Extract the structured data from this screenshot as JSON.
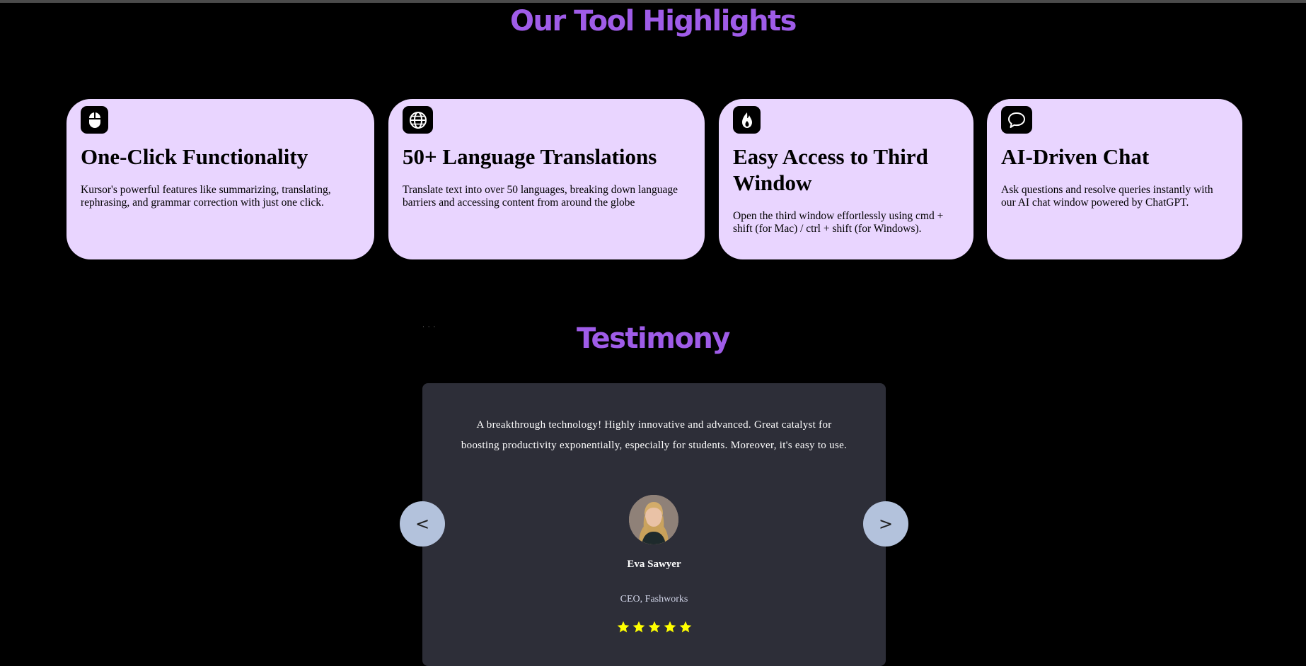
{
  "highlights": {
    "title": "Our Tool Highlights",
    "cards": [
      {
        "icon": "mouse-icon",
        "title": "One-Click Functionality",
        "description": "Kursor's powerful features like summarizing, translating, rephrasing, and grammar correction with just one click."
      },
      {
        "icon": "globe-icon",
        "title": "50+ Language Translations",
        "description": "Translate text into over 50 languages, breaking down language barriers and accessing content from around the globe"
      },
      {
        "icon": "flame-icon",
        "title": "Easy Access to Third Window",
        "description": "Open the third window effortlessly using cmd + shift (for Mac) / ctrl + shift (for Windows)."
      },
      {
        "icon": "chat-bubble-icon",
        "title": "AI-Driven Chat",
        "description": "Ask questions and resolve queries instantly with our AI chat window powered by ChatGPT."
      }
    ]
  },
  "testimony": {
    "title": "Testimony",
    "prev_label": "<",
    "next_label": ">",
    "quote": "A breakthrough technology! Highly innovative and advanced. Great catalyst for boosting productivity exponentially, especially for students. Moreover, it's easy to use.",
    "author_name": "Eva Sawyer",
    "author_role": "CEO, Fashworks",
    "rating": 5,
    "rating_max": 5
  },
  "colors": {
    "background": "#000000",
    "accent": "#9f5ce8",
    "card": "#e9d5ff",
    "testimonial_card": "#2d2e38",
    "nav_button": "#b3c2dc",
    "star": "#ffff00"
  }
}
